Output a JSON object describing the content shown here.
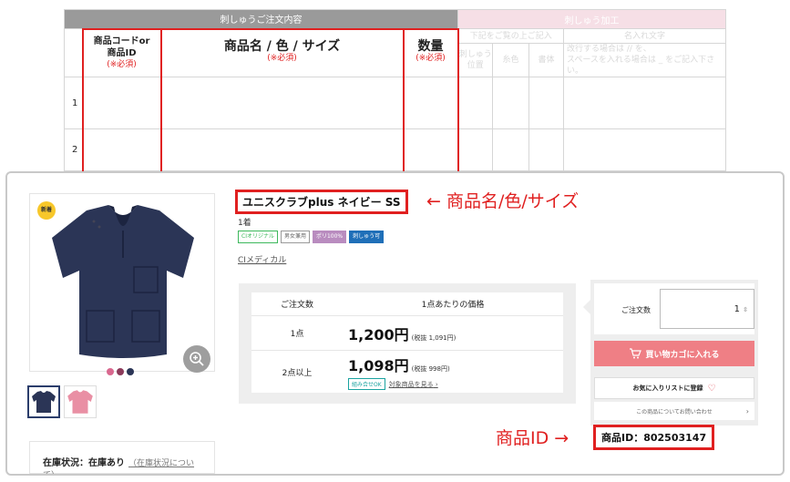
{
  "order_form": {
    "section_title": "刺しゅうご注文内容",
    "embroidery_title": "刺しゅう加工",
    "col_code": "商品コードor",
    "col_code_2": "商品ID",
    "required": "(※必須)",
    "col_name": "商品名 / 色 / サイズ",
    "col_qty": "数量",
    "emb_note": "下記をご覧の上ご記入",
    "emb_position": "刺しゅう位置",
    "emb_color": "糸色",
    "emb_font": "書体",
    "name_text": "名入れ文字",
    "name_note_1": "改行する場合は // を、",
    "name_note_2": "スペースを入れる場合は _ をご記入下さい。",
    "rows": [
      "1",
      "2"
    ]
  },
  "product": {
    "badge": "新着",
    "name": "ユニスクラブplus ネイビー SS",
    "name_annotation": "← 商品名/色/サイズ",
    "sub": "1着",
    "tags": [
      {
        "label": "CIオリジナル",
        "color": "#3db85c"
      },
      {
        "label": "男女兼用",
        "color": "#888888"
      },
      {
        "label": "ポリ100%",
        "color": "#b98cbf"
      },
      {
        "label": "刺しゅう可",
        "color": "#1f6fb8"
      }
    ],
    "brand": "CIメディカル",
    "swatch_colors": [
      "#d9688f",
      "#8c3a5a",
      "#2b3556"
    ],
    "stock_label": "在庫状況：",
    "stock_value": "在庫あり",
    "stock_link": "（在庫状況について）"
  },
  "pricing": {
    "header_qty": "ご注文数",
    "header_price": "1点あたりの価格",
    "rows": [
      {
        "qty": "1点",
        "price": "1,200円",
        "tax": "(税抜 1,091円)"
      },
      {
        "qty": "2点以上",
        "price": "1,098円",
        "tax": "(税抜 998円)"
      }
    ],
    "bundle_tag": "組み合せOK",
    "see_link": "対象商品を見る"
  },
  "cart": {
    "qty_label": "ご注文数",
    "qty_value": "1",
    "cart_button": "買い物カゴに入れる",
    "fav_button": "お気に入りリストに登録",
    "inquiry": "この商品についてお問い合わせ",
    "id_annotation": "商品ID →",
    "product_id": "商品ID：802503147"
  },
  "colors": {
    "accent_red": "#e02020",
    "cart_pink": "#ef7f85",
    "navy": "#2b3556"
  }
}
